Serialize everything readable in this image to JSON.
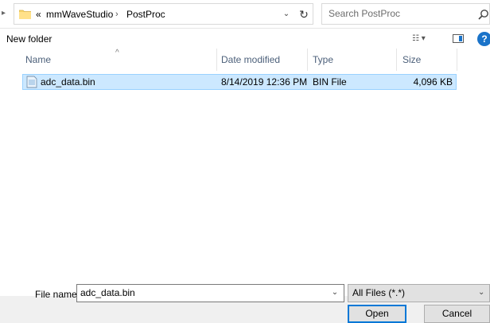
{
  "address": {
    "overflow": "«",
    "crumbs": [
      "mmWaveStudio",
      "PostProc"
    ],
    "separator": "›"
  },
  "search": {
    "placeholder": "Search PostProc"
  },
  "toolbar": {
    "new_folder": "New folder"
  },
  "columns": {
    "name": "Name",
    "date": "Date modified",
    "type": "Type",
    "size": "Size"
  },
  "files": [
    {
      "name": "adc_data.bin",
      "date": "8/14/2019 12:36 PM",
      "type": "BIN File",
      "size": "4,096 KB",
      "selected": true
    }
  ],
  "bottom": {
    "file_name_label": "File name:",
    "file_name_value": "adc_data.bin",
    "filter_value": "All Files (*.*)",
    "open_label": "Open",
    "cancel_label": "Cancel"
  },
  "icons": [
    "folder-icon",
    "refresh-icon",
    "search-icon",
    "view-options-icon",
    "preview-pane-icon",
    "help-icon",
    "file-icon"
  ],
  "colors": {
    "selection": "#cce8ff",
    "selection_border": "#99d1ff",
    "accent": "#0078d7"
  }
}
